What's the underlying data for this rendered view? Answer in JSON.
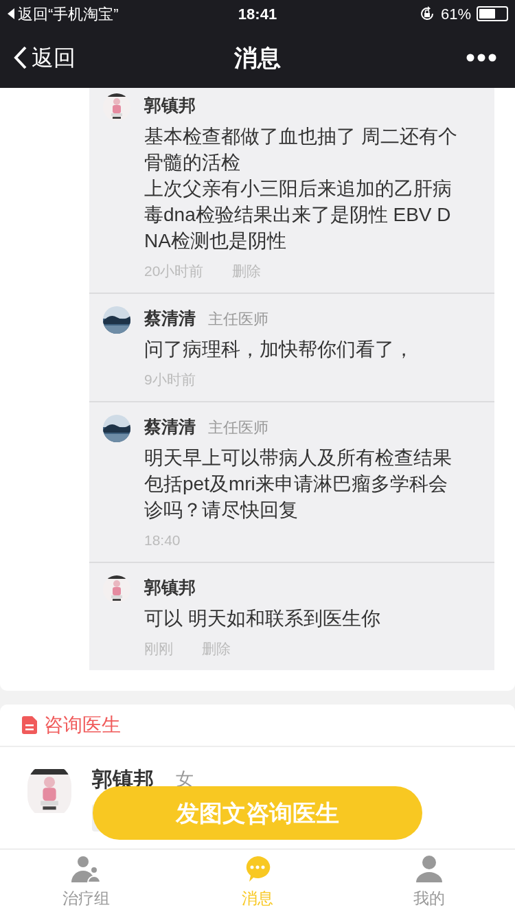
{
  "status_bar": {
    "back_app": "返回“手机淘宝”",
    "time": "18:41",
    "battery": "61%"
  },
  "nav": {
    "back": "返回",
    "title": "消息"
  },
  "comments": [
    {
      "author": "郭镇邦",
      "paragraphs": [
        "基本检查都做了血也抽了 周二还有个骨髓的活检",
        "上次父亲有小三阳后来追加的乙肝病毒dna检验结果出来了是阴性 EBV DNA检测也是阴性"
      ],
      "time": "20小时前",
      "delete": "删除"
    },
    {
      "author": "蔡清清",
      "role": "主任医师",
      "paragraphs": [
        "问了病理科，加快帮你们看了，"
      ],
      "time": "9小时前"
    },
    {
      "author": "蔡清清",
      "role": "主任医师",
      "paragraphs": [
        "明天早上可以带病人及所有检查结果包括pet及mri来申请淋巴瘤多学科会诊吗？请尽快回复"
      ],
      "time": "18:40"
    },
    {
      "author": "郭镇邦",
      "paragraphs": [
        "可以 明天如和联系到医生你"
      ],
      "time": "刚刚",
      "delete": "删除"
    }
  ],
  "consult": {
    "title": "咨询医生",
    "patient_name": "郭镇邦",
    "gender": "女"
  },
  "action_button": "发图文咨询医生",
  "tabs": [
    {
      "label": "治疗组",
      "selected": false
    },
    {
      "label": "消息",
      "selected": true
    },
    {
      "label": "我的",
      "selected": false
    }
  ]
}
